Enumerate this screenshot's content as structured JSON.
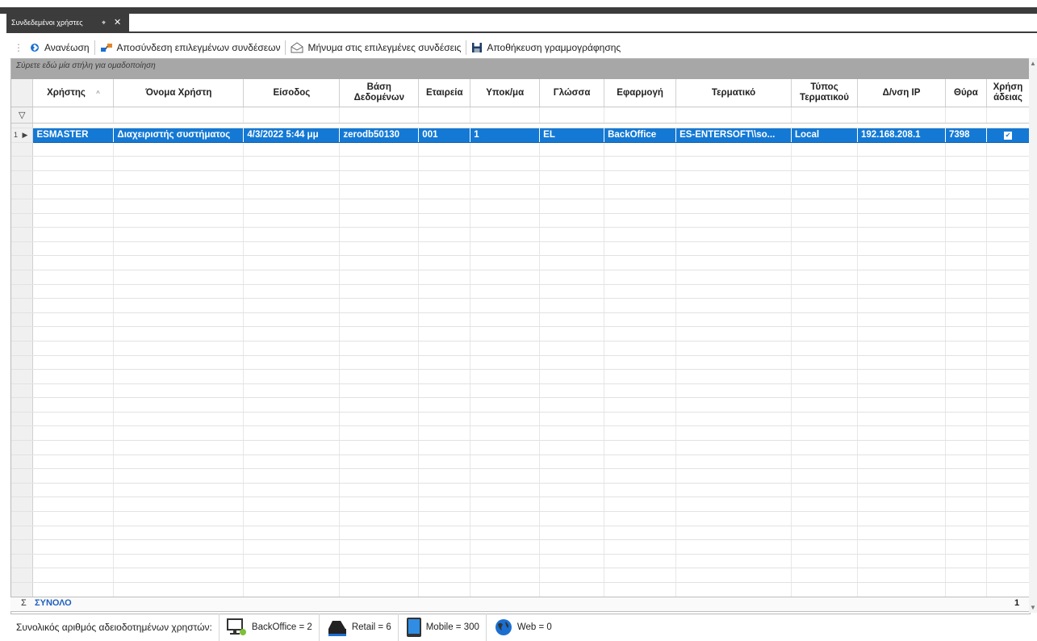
{
  "tab": {
    "title": "Συνδεδεμένοι χρήστες",
    "pin": "⌖",
    "close": "✕"
  },
  "toolbar": {
    "refresh": "Ανανέωση",
    "disconnect": "Αποσύνδεση επιλεγμένων συνδέσεων",
    "message": "Μήνυμα στις επιλεγμένες συνδέσεις",
    "save_layout": "Αποθήκευση γραμμογράφησης"
  },
  "grid": {
    "group_hint": "Σύρετε εδώ μία στήλη για ομαδοποίηση",
    "columns": {
      "user": "Χρήστης",
      "username": "Όνομα Χρήστη",
      "login": "Είσοδος",
      "database": "Βάση Δεδομένων",
      "company": "Εταιρεία",
      "branch": "Υποκ/μα",
      "language": "Γλώσσα",
      "application": "Εφαρμογή",
      "terminal": "Τερματικό",
      "terminal_type": "Τύπος Τερματικού",
      "ip": "Δ/νση IP",
      "port": "Θύρα",
      "license_use": "Χρήση άδειας"
    },
    "rows": [
      {
        "num": "1",
        "user": "ESMASTER",
        "username": "Διαχειριστής συστήματος",
        "login": "4/3/2022 5:44 μμ",
        "database": "zerodb50130",
        "company": "001",
        "branch": "1",
        "language": "EL",
        "application": "BackOffice",
        "terminal": "ES-ENTERSOFT\\\\so...",
        "terminal_type": "Local",
        "ip": "192.168.208.1",
        "port": "7398",
        "license_use": true
      }
    ],
    "footer": {
      "sigma": "Σ",
      "total_label": "ΣΥΝΟΛΟ",
      "count": "1"
    }
  },
  "status": {
    "label": "Συνολικός αριθμός αδειοδοτημένων χρηστών:",
    "backoffice": "BackOffice = 2",
    "retail": "Retail = 6",
    "mobile": "Mobile = 300",
    "web": "Web = 0"
  },
  "colors": {
    "selection": "#1479d4",
    "dark_frame": "#3c3c3c",
    "group_panel": "#a7a7a7"
  }
}
